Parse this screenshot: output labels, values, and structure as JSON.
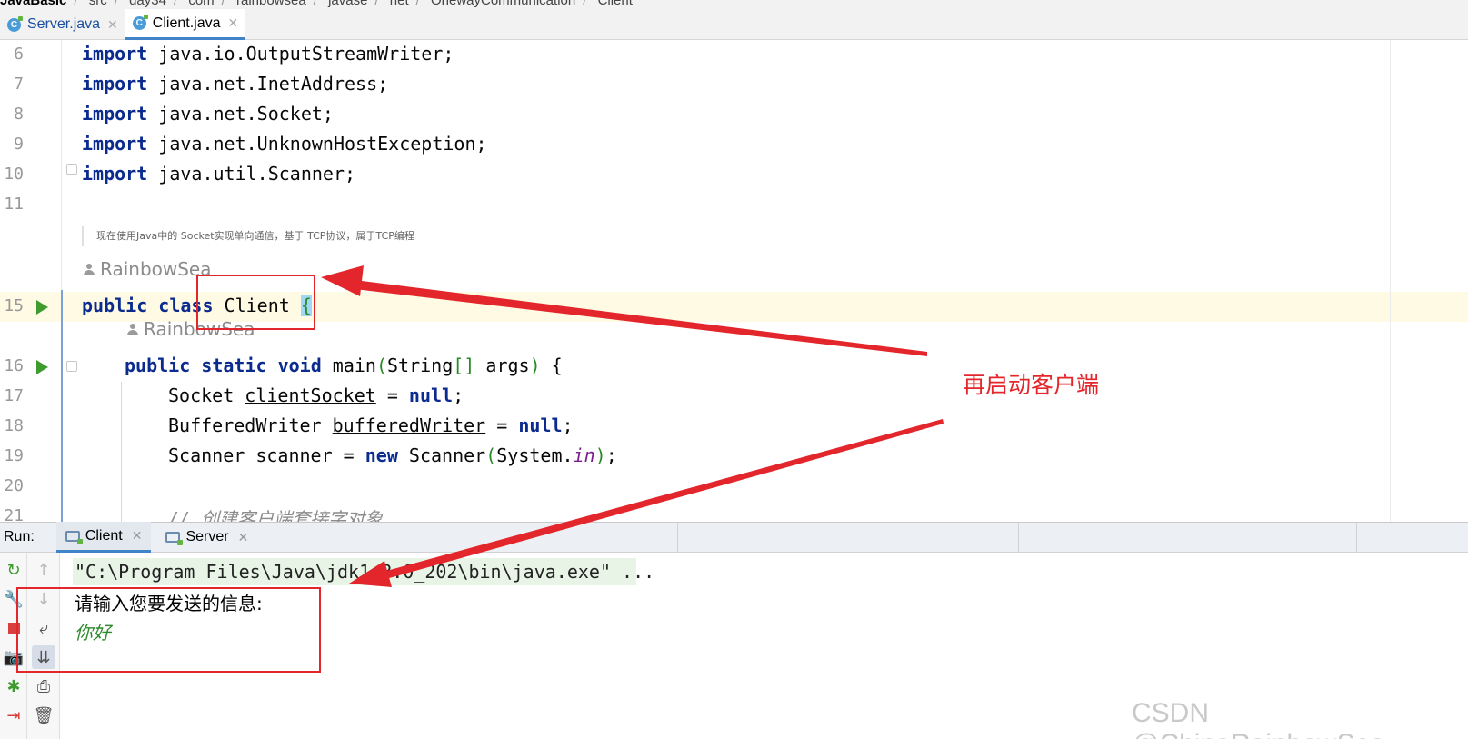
{
  "breadcrumb": [
    "JavaBasic",
    "src",
    "day34",
    "com",
    "rainbowsea",
    "javase",
    "net",
    "OnewayCommunication",
    "Client"
  ],
  "tabs": [
    {
      "label": "Server.java",
      "active": false
    },
    {
      "label": "Client.java",
      "active": true
    }
  ],
  "editor": {
    "lines": [
      {
        "num": "6",
        "kw": "import",
        "rest": " java.io.OutputStreamWriter;"
      },
      {
        "num": "7",
        "kw": "import",
        "rest": " java.net.InetAddress;"
      },
      {
        "num": "8",
        "kw": "import",
        "rest": " java.net.Socket;"
      },
      {
        "num": "9",
        "kw": "import",
        "rest": " java.net.UnknownHostException;"
      },
      {
        "num": "10",
        "kw": "import",
        "rest": " java.util.Scanner;"
      },
      {
        "num": "11"
      }
    ],
    "doc_comment": "现在使用Java中的 Socket实现单向通信，基于 TCP协议，属于TCP编程",
    "author": "RainbowSea",
    "class_line": {
      "num": "15",
      "kw": "public class",
      "name": "Client",
      "brace": "{"
    },
    "main_line": {
      "num": "16",
      "kw": "public static void",
      "name": "main",
      "open": "(",
      "params_type": "String",
      "brackets": "[]",
      "params_name": " args",
      "close": ")",
      "brace": "{"
    },
    "line17": {
      "num": "17",
      "type": "Socket ",
      "var": "clientSocket",
      "eq": " = ",
      "val": "null",
      "end": ";"
    },
    "line18": {
      "num": "18",
      "type": "BufferedWriter ",
      "var": "bufferedWriter",
      "eq": " = ",
      "val": "null",
      "end": ";"
    },
    "line19": {
      "num": "19",
      "pre": "Scanner scanner = ",
      "kw": "new",
      "ctor": " Scanner",
      "open": "(",
      "sys": "System.",
      "field": "in",
      "close": ")",
      "end": ";"
    },
    "line20": {
      "num": "20"
    },
    "line21": {
      "num": "21",
      "comment": "// 创建客户端套接字对象"
    }
  },
  "run": {
    "label": "Run:",
    "tabs": [
      {
        "label": "Client",
        "active": true
      },
      {
        "label": "Server",
        "active": false
      }
    ],
    "command": "\"C:\\Program Files\\Java\\jdk1.8.0_202\\bin\\java.exe\" ...",
    "prompt": "请输入您要发送的信息:",
    "user_input": "你好"
  },
  "annotation": {
    "text": "再启动客户端",
    "color": "#e3262b"
  },
  "watermark": "CSDN @ChinaRainbowSea",
  "colors": {
    "keyword": "#0b2b8f",
    "caret_line": "#fffae3",
    "run_green": "#3f9b2e",
    "accent": "#4083c9"
  }
}
